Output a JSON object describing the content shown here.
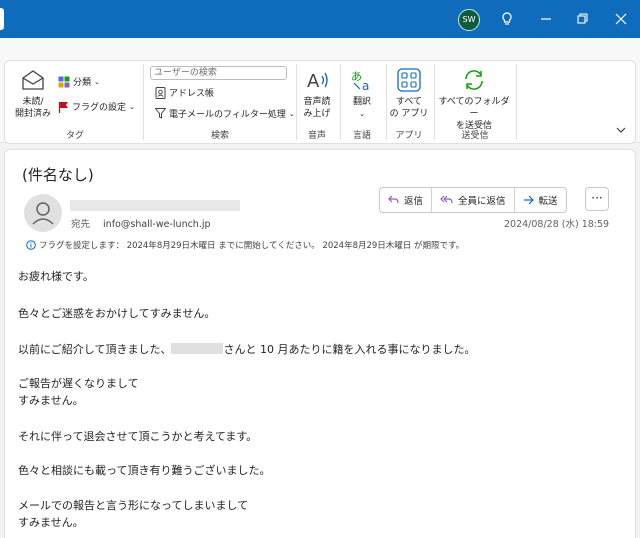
{
  "titlebar": {
    "avatar_initials": "SW",
    "icons": [
      "lightbulb-icon",
      "minimize-icon",
      "restore-icon",
      "close-icon"
    ]
  },
  "ribbon": {
    "groups": {
      "tags": "タグ",
      "search": "検索",
      "speech": "音声",
      "language": "言語",
      "apps": "アプリ",
      "send_receive": "送受信"
    },
    "unread_read_line1": "未読/",
    "unread_read_line2": "開封済み",
    "categorize": "分類",
    "set_flag": "フラグの設定",
    "search_placeholder": "ユーザーの検索",
    "address_book": "アドレス帳",
    "filter_email": "電子メールのフィルター処理",
    "read_aloud_line1": "音声読",
    "read_aloud_line2": "み上げ",
    "translate": "翻訳",
    "all_apps_line1": "すべて",
    "all_apps_line2": "の アプリ",
    "send_receive_all_line1": "すべてのフォルダー",
    "send_receive_all_line2": "を送受信"
  },
  "message": {
    "subject": "(件名なし)",
    "to_label": "宛先",
    "to_address": "info@shall-we-lunch.jp",
    "actions": {
      "reply": "返信",
      "reply_all": "全員に返信",
      "forward": "転送"
    },
    "more": "···",
    "date": "2024/08/28 (水) 18:59",
    "flag_info": "フラグを設定します： 2024年8月29日木曜日 までに開始してください。 2024年8月29日木曜日 が期限です。",
    "body": {
      "l1": "お疲れ様です。",
      "l2": "色々とご迷惑をおかけしてすみません。",
      "l3a": "以前にご紹介して頂きました、",
      "l3b": "さんと 10 月あたりに籍を入れる事になりました。",
      "l4": "ご報告が遅くなりまして",
      "l5": "すみません。",
      "l6": "それに伴って退会させて頂こうかと考えてます。",
      "l7": "色々と相談にも載って頂き有り難うございました。",
      "l8": "メールでの報告と言う形になってしまいまして",
      "l9": "すみません。"
    }
  },
  "colors": {
    "titlebar": "#0f6cbd",
    "accent_blue": "#0f6cbd",
    "flag_red": "#c50f1f",
    "sync_green": "#13a10e"
  }
}
